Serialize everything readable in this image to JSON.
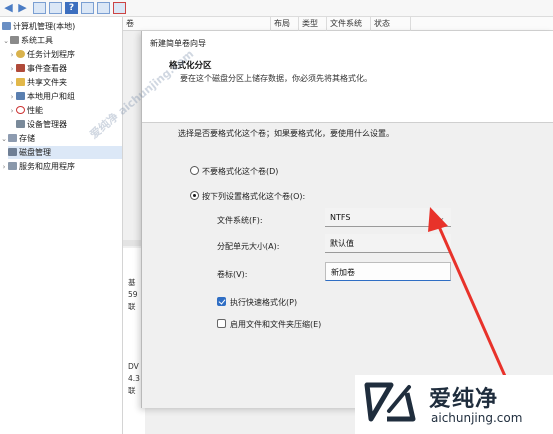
{
  "tree": {
    "items": [
      {
        "label": "计算机管理(本地)",
        "icon": "computer-icon"
      },
      {
        "label": "系统工具",
        "icon": "tools-icon"
      },
      {
        "label": "任务计划程序",
        "icon": "clock-icon"
      },
      {
        "label": "事件查看器",
        "icon": "event-viewer-icon"
      },
      {
        "label": "共享文件夹",
        "icon": "shared-folder-icon"
      },
      {
        "label": "本地用户和组",
        "icon": "users-icon"
      },
      {
        "label": "性能",
        "icon": "performance-icon"
      },
      {
        "label": "设备管理器",
        "icon": "device-manager-icon"
      },
      {
        "label": "存储",
        "icon": "storage-icon"
      },
      {
        "label": "磁盘管理",
        "icon": "disk-icon"
      },
      {
        "label": "服务和应用程序",
        "icon": "services-icon"
      }
    ]
  },
  "list": {
    "columns": [
      "卷",
      "布局",
      "类型",
      "文件系统",
      "状态"
    ]
  },
  "disks": {
    "lines": [
      "基",
      "59",
      "联",
      "DV",
      "4.3",
      "联"
    ]
  },
  "wizard": {
    "title": "新建简单卷向导",
    "heading": "格式化分区",
    "subheading": "要在这个磁盘分区上储存数据，你必须先将其格式化。",
    "prompt": "选择是否要格式化这个卷；如果要格式化，要使用什么设置。",
    "option_no": "不要格式化这个卷(D)",
    "option_yes": "按下列设置格式化这个卷(O):",
    "fs_label": "文件系统(F):",
    "fs_value": "NTFS",
    "alloc_label": "分配单元大小(A):",
    "alloc_value": "默认值",
    "vol_label": "卷标(V):",
    "vol_value": "新加卷",
    "quick_format": "执行快速格式化(P)",
    "compression": "启用文件和文件夹压缩(E)"
  },
  "watermark": {
    "diagonal": "爱纯净 aichunjing.com",
    "logo_text": "爱纯净",
    "logo_url": "aichunjing.com"
  },
  "colors": {
    "arrow": "#e8322a",
    "accent": "#2f6ec4"
  }
}
